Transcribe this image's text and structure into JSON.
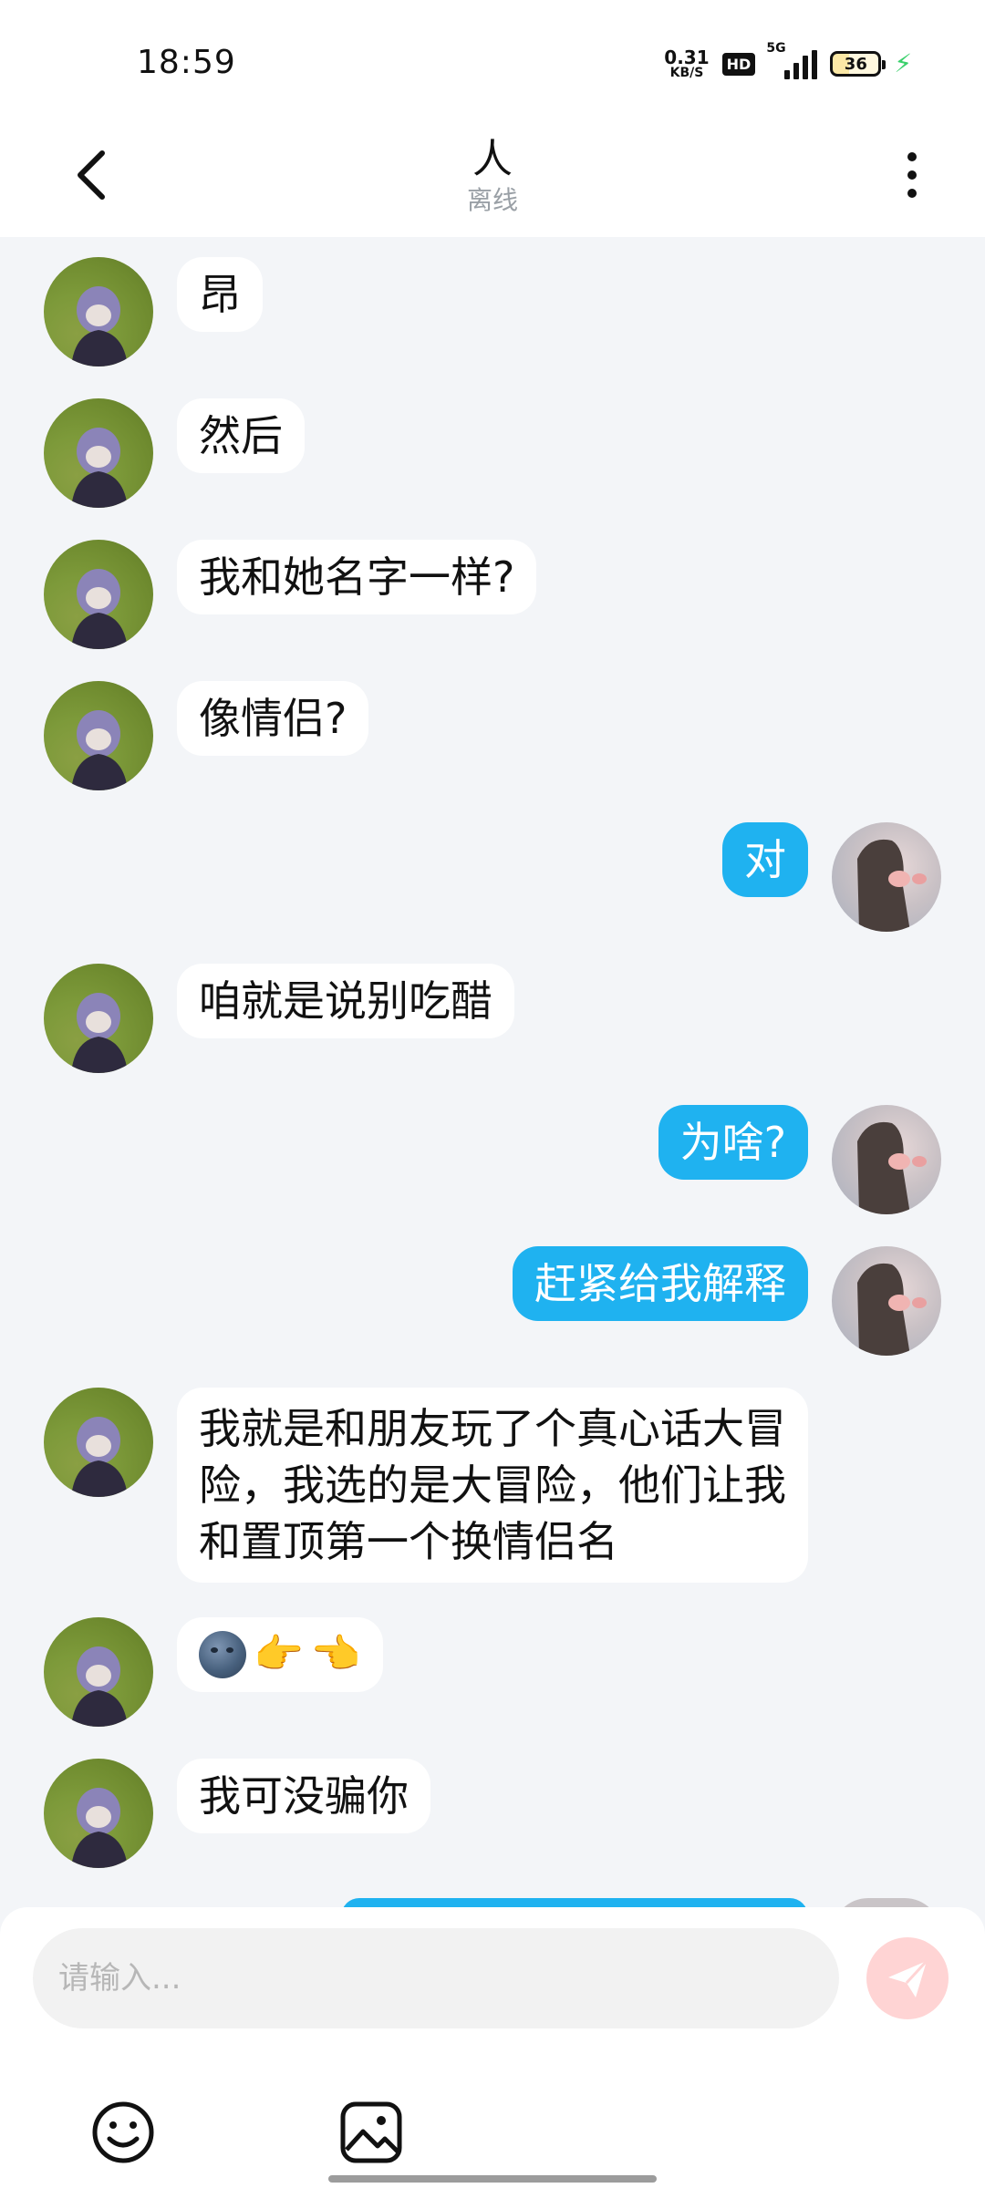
{
  "status_bar": {
    "time": "18:59",
    "net_speed_value": "0.31",
    "net_speed_unit": "KB/S",
    "hd": "HD",
    "signal_label": "5G",
    "battery": "36"
  },
  "header": {
    "title": "人",
    "status": "离线"
  },
  "messages": [
    {
      "side": "left",
      "text": "昂"
    },
    {
      "side": "left",
      "text": "然后"
    },
    {
      "side": "left",
      "text": "我和她名字一样?"
    },
    {
      "side": "left",
      "text": "像情侣?"
    },
    {
      "side": "right",
      "text": "对"
    },
    {
      "side": "left",
      "text": "咱就是说别吃醋"
    },
    {
      "side": "right",
      "text": "为啥?"
    },
    {
      "side": "right",
      "text": "赶紧给我解释"
    },
    {
      "side": "left",
      "text": "我就是和朋友玩了个真心话大冒险，我选的是大冒险，他们让我和置顶第一个换情侣名"
    },
    {
      "side": "left",
      "emojis": [
        "new-moon-face",
        "pointing-right-hand",
        "pointing-left-hand"
      ]
    },
    {
      "side": "left",
      "text": "我可没骗你"
    }
  ],
  "composer": {
    "placeholder": "请输入..."
  },
  "colors": {
    "outgoing_bubble": "#1fb2f0",
    "incoming_bubble": "#ffffff",
    "send_button": "#ffd4d4",
    "background": "#f3f5f8"
  }
}
